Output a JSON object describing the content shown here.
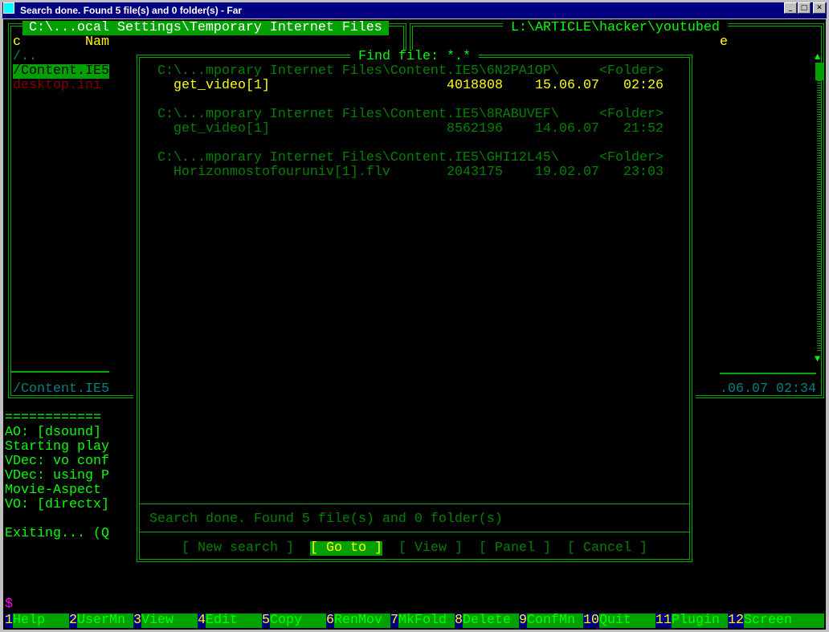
{
  "window": {
    "title": "Search done. Found 5 file(s) and 0 folder(s) - Far"
  },
  "left_panel": {
    "path": "C:\\...ocal Settings\\Temporary Internet Files",
    "col_c": "c",
    "col_name": "Nam",
    "items": [
      {
        "name": "/..",
        "color": "#008080"
      },
      {
        "name": "/Content.IE5",
        "selected": true
      },
      {
        "name": "desktop.ini",
        "color": "#800000"
      }
    ],
    "info": "/Content.IE5"
  },
  "right_panel": {
    "path": "L:\\ARTICLE\\hacker\\youtubed",
    "col_e": "e",
    "info": ".06.07 02:34",
    "scroll_up": "▲",
    "scroll_down": "▼"
  },
  "console": {
    "lines": [
      "============",
      "AO: [dsound]",
      "Starting play",
      "VDec: vo conf",
      "VDec: using P",
      "Movie-Aspect",
      "VO: [directx]",
      "",
      "Exiting... (Q"
    ],
    "prompt": "$"
  },
  "dialog": {
    "title": "Find file: *.*",
    "results": [
      {
        "folder": "C:\\...mporary Internet Files\\Content.IE5\\6N2PA1OP\\",
        "folder_tag": "<Folder>",
        "file": "get_video[1]",
        "size": "4018808",
        "date": "15.06.07",
        "time": "02:26",
        "selected": true
      },
      {
        "folder": "C:\\...mporary Internet Files\\Content.IE5\\8RABUVEF\\",
        "folder_tag": "<Folder>",
        "file": "get_video[1]",
        "size": "8562196",
        "date": "14.06.07",
        "time": "21:52"
      },
      {
        "folder": "C:\\...mporary Internet Files\\Content.IE5\\GHI12L45\\",
        "folder_tag": "<Folder>",
        "file": "Horizonmostofouruniv[1].flv",
        "size": "2043175",
        "date": "19.02.07",
        "time": "23:03"
      }
    ],
    "status": "Search done. Found 5 file(s) and 0 folder(s)",
    "buttons": [
      {
        "label": "[ New search ]",
        "hotkey": "N"
      },
      {
        "label": "[ Go to ]",
        "focused": true
      },
      {
        "label": "[ View ]"
      },
      {
        "label": "[ Panel ]"
      },
      {
        "label": "[ Cancel ]"
      }
    ]
  },
  "keybar": [
    {
      "n": "1",
      "l": "Help"
    },
    {
      "n": "2",
      "l": "UserMn"
    },
    {
      "n": "3",
      "l": "View"
    },
    {
      "n": "4",
      "l": "Edit"
    },
    {
      "n": "5",
      "l": "Copy"
    },
    {
      "n": "6",
      "l": "RenMov"
    },
    {
      "n": "7",
      "l": "MkFold"
    },
    {
      "n": "8",
      "l": "Delete"
    },
    {
      "n": "9",
      "l": "ConfMn"
    },
    {
      "n": "10",
      "l": "Quit"
    },
    {
      "n": "11",
      "l": "Plugin"
    },
    {
      "n": "12",
      "l": "Screen"
    }
  ]
}
